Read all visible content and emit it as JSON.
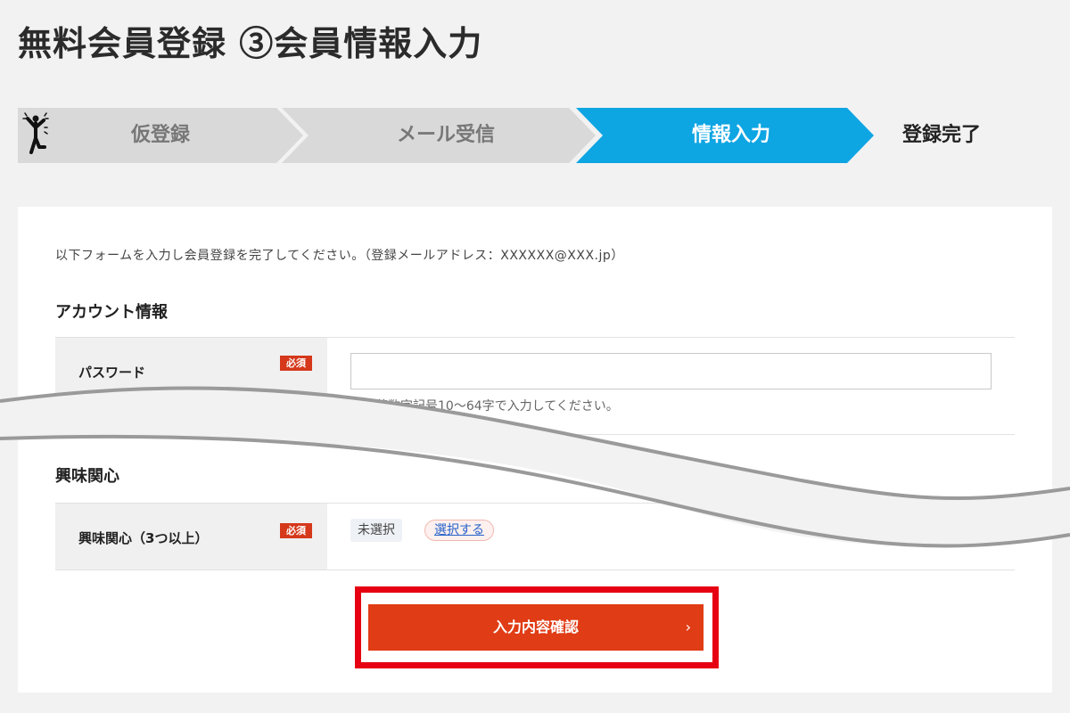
{
  "header": {
    "title": "無料会員登録 ③会員情報入力"
  },
  "steps": [
    {
      "label": "仮登録",
      "state": "done"
    },
    {
      "label": "メール受信",
      "state": "done"
    },
    {
      "label": "情報入力",
      "state": "active"
    },
    {
      "label": "登録完了",
      "state": "pending"
    }
  ],
  "colors": {
    "active_step": "#0ea5e3",
    "inactive_step": "#d9d9d9",
    "required": "#d5381b",
    "button": "#e03c15",
    "highlight_frame": "#e60012"
  },
  "form": {
    "intro": "以下フォームを入力し会員登録を完了してください。（登録メールアドレス：XXXXXX@XXX.jp）",
    "account_section": {
      "title": "アカウント情報",
      "password": {
        "label": "パスワード",
        "required_badge": "必須",
        "value": "",
        "placeholder": "",
        "hint": "半角英数字記号10〜64字で入力してください。"
      }
    },
    "interest_section": {
      "title": "興味関心",
      "interests": {
        "label": "興味関心（3つ以上）",
        "required_badge": "必須",
        "status": "未選択",
        "select_link": "選択する"
      }
    },
    "confirm_button": {
      "label": "入力内容確認",
      "arrow": "›"
    }
  },
  "icons": {
    "finish": "person-cheering-icon"
  }
}
